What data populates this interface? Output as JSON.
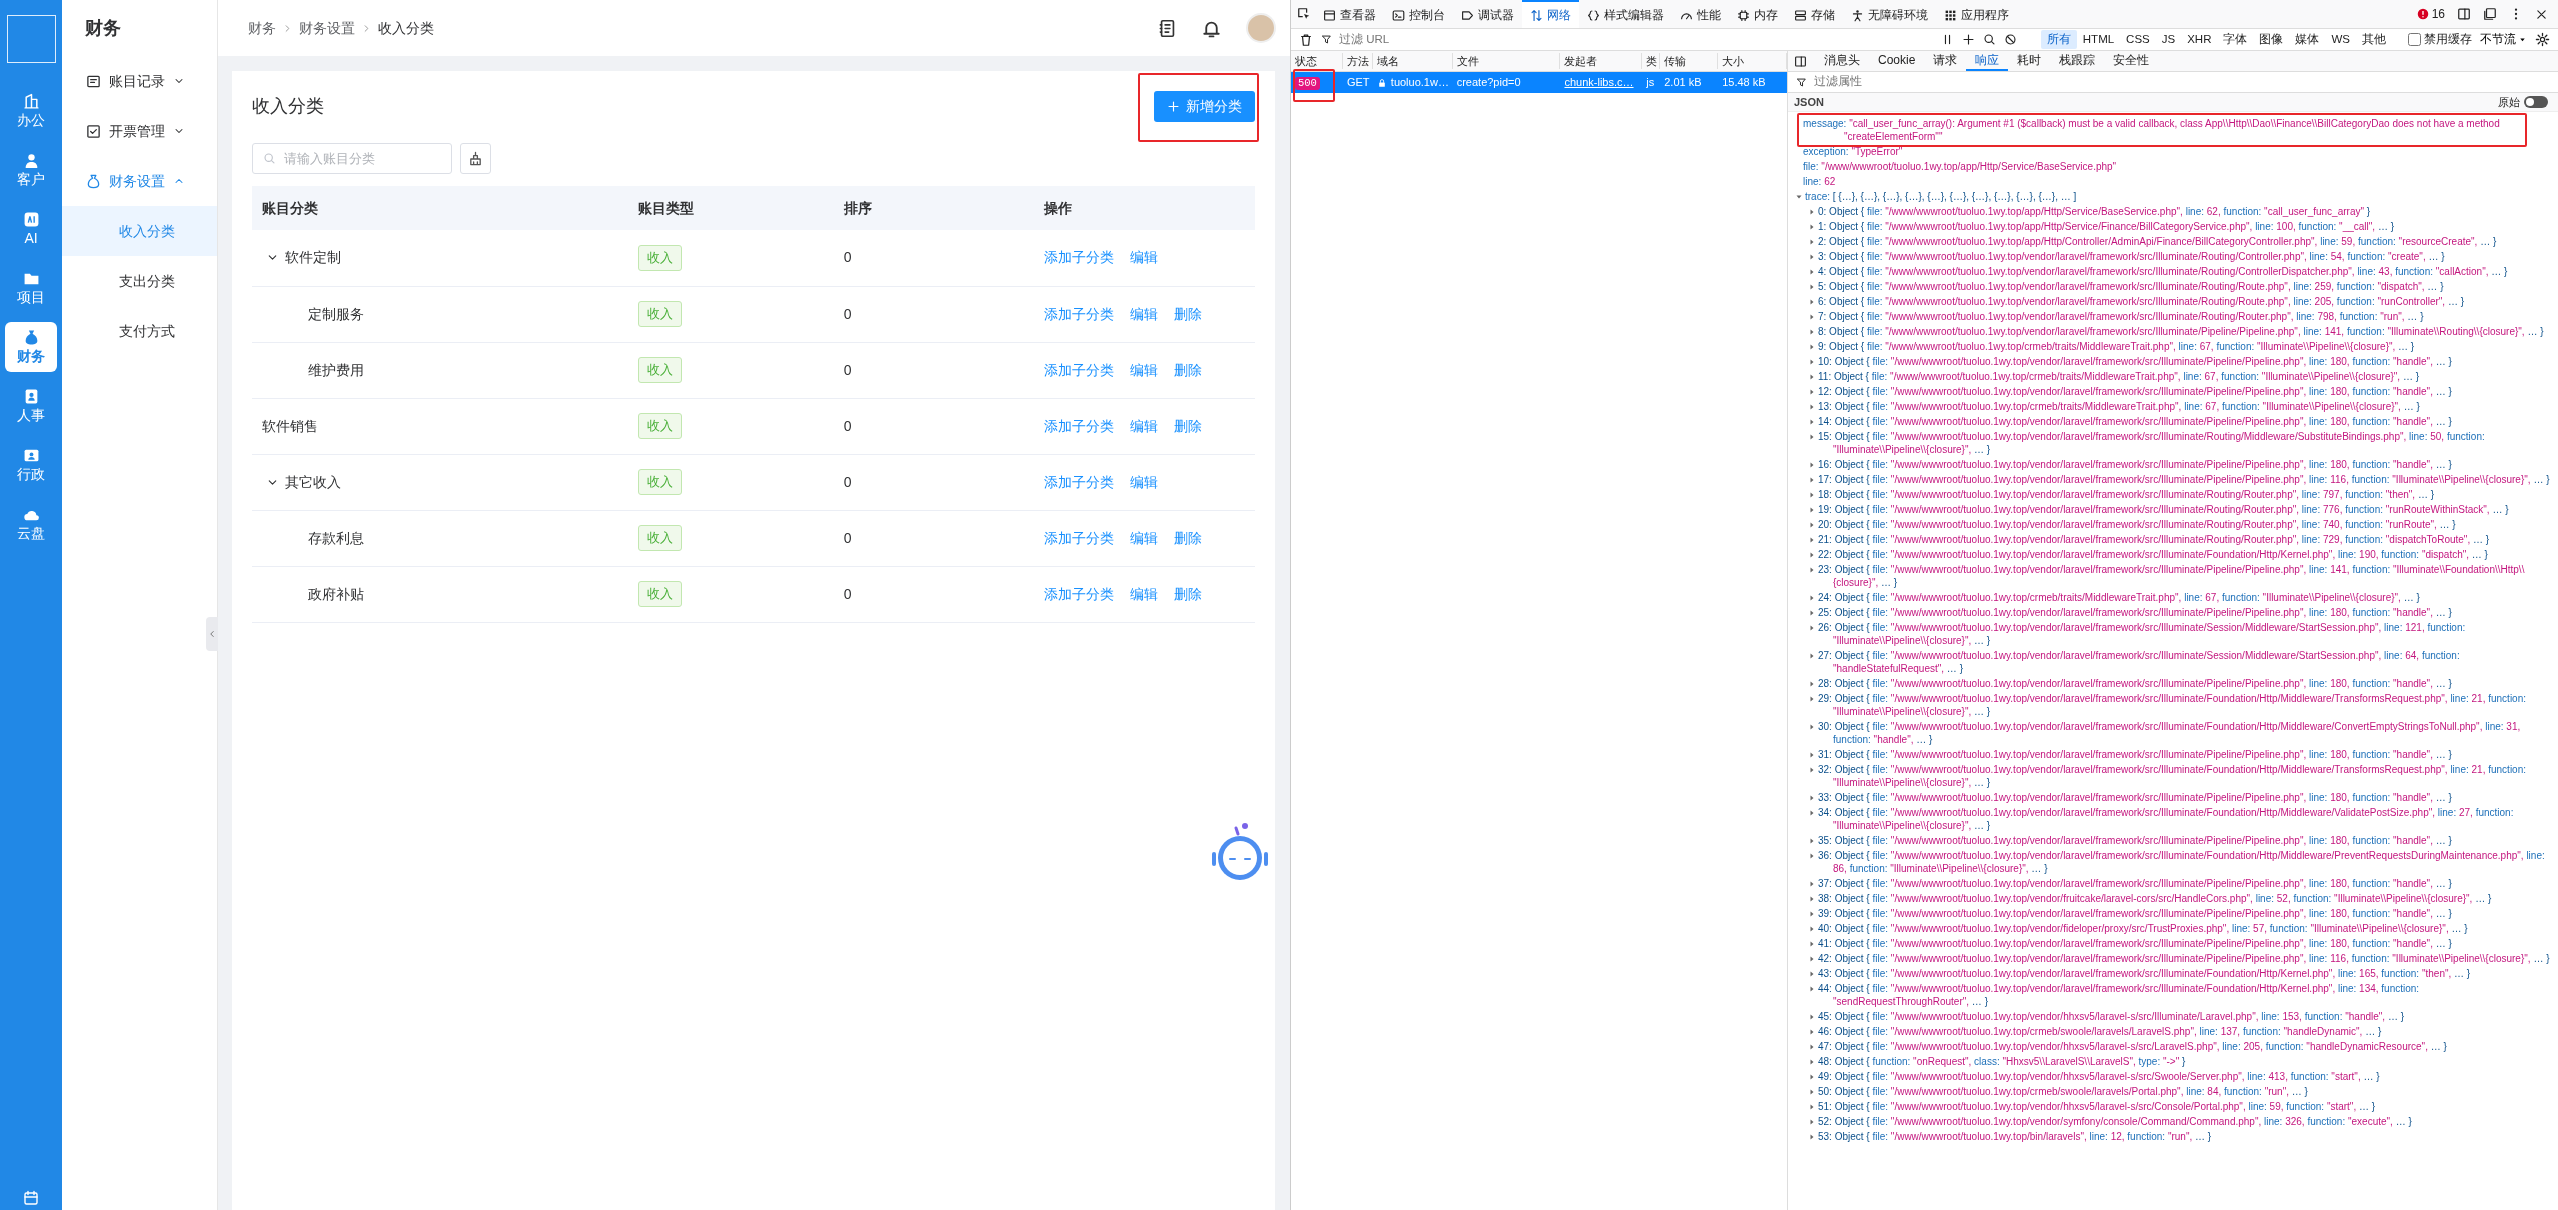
{
  "rail": {
    "items": [
      {
        "label": "办公",
        "selected": false
      },
      {
        "label": "客户",
        "selected": false
      },
      {
        "label": "AI",
        "selected": false
      },
      {
        "label": "项目",
        "selected": false
      },
      {
        "label": "财务",
        "selected": true
      },
      {
        "label": "人事",
        "selected": false
      },
      {
        "label": "行政",
        "selected": false
      },
      {
        "label": "云盘",
        "selected": false
      }
    ]
  },
  "subnav": {
    "title": "财务",
    "items": [
      {
        "label": "账目记录",
        "expanded": false
      },
      {
        "label": "开票管理",
        "expanded": false
      },
      {
        "label": "财务设置",
        "expanded": true,
        "children": [
          {
            "label": "收入分类",
            "selected": true
          },
          {
            "label": "支出分类",
            "selected": false
          },
          {
            "label": "支付方式",
            "selected": false
          }
        ]
      }
    ]
  },
  "breadcrumb": [
    "财务",
    "财务设置",
    "收入分类"
  ],
  "page": {
    "title": "收入分类",
    "add_button": {
      "label": "新增分类",
      "highlighted": true
    },
    "search": {
      "placeholder": "请输入账目分类"
    },
    "table": {
      "columns": [
        "账目分类",
        "账目类型",
        "排序",
        "操作"
      ],
      "rows": [
        {
          "name": "软件定制",
          "type": "收入",
          "sort": "0",
          "actions": [
            "添加子分类",
            "编辑"
          ],
          "expanded": true,
          "children": [
            {
              "name": "定制服务",
              "type": "收入",
              "sort": "0",
              "actions": [
                "添加子分类",
                "编辑",
                "删除"
              ]
            },
            {
              "name": "维护费用",
              "type": "收入",
              "sort": "0",
              "actions": [
                "添加子分类",
                "编辑",
                "删除"
              ]
            }
          ]
        },
        {
          "name": "软件销售",
          "type": "收入",
          "sort": "0",
          "actions": [
            "添加子分类",
            "编辑",
            "删除"
          ]
        },
        {
          "name": "其它收入",
          "type": "收入",
          "sort": "0",
          "actions": [
            "添加子分类",
            "编辑"
          ],
          "expanded": true,
          "children": [
            {
              "name": "存款利息",
              "type": "收入",
              "sort": "0",
              "actions": [
                "添加子分类",
                "编辑",
                "删除"
              ]
            },
            {
              "name": "政府补贴",
              "type": "收入",
              "sort": "0",
              "actions": [
                "添加子分类",
                "编辑",
                "删除"
              ]
            }
          ]
        }
      ]
    }
  },
  "devtools": {
    "tabs": [
      {
        "label": "查看器",
        "selected": false
      },
      {
        "label": "控制台",
        "selected": false
      },
      {
        "label": "调试器",
        "selected": false
      },
      {
        "label": "网络",
        "selected": true
      },
      {
        "label": "样式编辑器",
        "selected": false
      },
      {
        "label": "性能",
        "selected": false
      },
      {
        "label": "内存",
        "selected": false
      },
      {
        "label": "存储",
        "selected": false
      },
      {
        "label": "无障碍环境",
        "selected": false
      },
      {
        "label": "应用程序",
        "selected": false
      }
    ],
    "error_count": "16",
    "url_filter": {
      "placeholder": "过滤 URL"
    },
    "type_filters": [
      {
        "label": "所有",
        "selected": true
      },
      {
        "label": "HTML",
        "selected": false
      },
      {
        "label": "CSS",
        "selected": false
      },
      {
        "label": "JS",
        "selected": false
      },
      {
        "label": "XHR",
        "selected": false
      },
      {
        "label": "字体",
        "selected": false
      },
      {
        "label": "图像",
        "selected": false
      },
      {
        "label": "媒体",
        "selected": false
      },
      {
        "label": "WS",
        "selected": false
      },
      {
        "label": "其他",
        "selected": false
      }
    ],
    "disable_cache": {
      "label": "禁用缓存",
      "checked": false
    },
    "throttle": "不节流",
    "requests": {
      "columns": [
        "状态",
        "方法",
        "域名",
        "文件",
        "发起者",
        "类",
        "传输",
        "大小"
      ],
      "rows": [
        {
          "status": "500",
          "status_highlighted": true,
          "method": "GET",
          "domain": "tuoluo.1w…",
          "file": "create?pid=0",
          "initiator": "chunk-libs.c…",
          "type": "js",
          "transferred": "2.01 kB",
          "size": "15.48 kB",
          "selected": true
        }
      ]
    },
    "detail_tabs": [
      {
        "label": "消息头",
        "selected": false
      },
      {
        "label": "Cookie",
        "selected": false
      },
      {
        "label": "请求",
        "selected": false
      },
      {
        "label": "响应",
        "selected": true
      },
      {
        "label": "耗时",
        "selected": false
      },
      {
        "label": "栈跟踪",
        "selected": false
      },
      {
        "label": "安全性",
        "selected": false
      }
    ],
    "property_filter": {
      "placeholder": "过滤属性"
    },
    "view_label": "JSON",
    "raw_toggle": {
      "label": "原始",
      "on": false
    },
    "properties": [
      {
        "key": "message:",
        "value": "\"call_user_func_array(): Argument #1 ($callback) must be a valid callback, class App\\\\Http\\\\Dao\\\\Finance\\\\BillCategoryDao does not have a method \"createElementForm\"\"",
        "highlighted": true
      },
      {
        "key": "exception:",
        "value": "\"TypeError\"",
        "highlighted": false
      },
      {
        "key": "file:",
        "value": "\"/www/wwwroot/tuoluo.1wy.top/app/Http/Service/BaseService.php\"",
        "highlighted": false
      },
      {
        "key": "line:",
        "value": "62",
        "highlighted": false
      }
    ],
    "trace": {
      "key": "trace:",
      "summary": "[ {…}, {…}, {…}, {…}, {…}, {…}, {…}, {…}, {…}, {…}, … ]",
      "expanded": true,
      "entries": [
        {
          "head": "0: Object {",
          "fields": [
            {
              "key": "file:",
              "value": "\"/www/wwwroot/tuoluo.1wy.top/app/Http/Service/BaseService.php\","
            },
            {
              "key": "line:",
              "value": "62,"
            },
            {
              "key": "function:",
              "value": "\"call_user_func_array\""
            }
          ],
          "tail": "}"
        },
        {
          "head": "1: Object {",
          "fields": [
            {
              "key": "file:",
              "value": "\"/www/wwwroot/tuoluo.1wy.top/app/Http/Service/Finance/BillCategoryService.php\","
            },
            {
              "key": "line:",
              "value": "100,"
            },
            {
              "key": "function:",
              "value": "\"__call\","
            }
          ],
          "tail": "… }"
        },
        {
          "head": "2: Object {",
          "fields": [
            {
              "key": "file:",
              "value": "\"/www/wwwroot/tuoluo.1wy.top/app/Http/Controller/AdminApi/Finance/BillCategoryController.php\","
            },
            {
              "key": "line:",
              "value": "59,"
            },
            {
              "key": "function:",
              "value": "\"resourceCreate\","
            }
          ],
          "tail": "… }"
        },
        {
          "head": "3: Object {",
          "fields": [
            {
              "key": "file:",
              "value": "\"/www/wwwroot/tuoluo.1wy.top/vendor/laravel/framework/src/Illuminate/Routing/Controller.php\","
            },
            {
              "key": "line:",
              "value": "54,"
            },
            {
              "key": "function:",
              "value": "\"create\","
            }
          ],
          "tail": "… }"
        },
        {
          "head": "4: Object {",
          "fields": [
            {
              "key": "file:",
              "value": "\"/www/wwwroot/tuoluo.1wy.top/vendor/laravel/framework/src/Illuminate/Routing/ControllerDispatcher.php\","
            },
            {
              "key": "line:",
              "value": "43,"
            },
            {
              "key": "function:",
              "value": "\"callAction\","
            }
          ],
          "tail": "… }"
        },
        {
          "head": "5: Object {",
          "fields": [
            {
              "key": "file:",
              "value": "\"/www/wwwroot/tuoluo.1wy.top/vendor/laravel/framework/src/Illuminate/Routing/Route.php\","
            },
            {
              "key": "line:",
              "value": "259,"
            },
            {
              "key": "function:",
              "value": "\"dispatch\","
            }
          ],
          "tail": "… }"
        },
        {
          "head": "6: Object {",
          "fields": [
            {
              "key": "file:",
              "value": "\"/www/wwwroot/tuoluo.1wy.top/vendor/laravel/framework/src/Illuminate/Routing/Route.php\","
            },
            {
              "key": "line:",
              "value": "205,"
            },
            {
              "key": "function:",
              "value": "\"runController\","
            }
          ],
          "tail": "… }"
        },
        {
          "head": "7: Object {",
          "fields": [
            {
              "key": "file:",
              "value": "\"/www/wwwroot/tuoluo.1wy.top/vendor/laravel/framework/src/Illuminate/Routing/Router.php\","
            },
            {
              "key": "line:",
              "value": "798,"
            },
            {
              "key": "function:",
              "value": "\"run\","
            }
          ],
          "tail": "… }"
        },
        {
          "head": "8: Object {",
          "fields": [
            {
              "key": "file:",
              "value": "\"/www/wwwroot/tuoluo.1wy.top/vendor/laravel/framework/src/Illuminate/Pipeline/Pipeline.php\","
            },
            {
              "key": "line:",
              "value": "141,"
            },
            {
              "key": "function:",
              "value": "\"Illuminate\\\\Routing\\\\{closure}\","
            }
          ],
          "tail": "… }"
        },
        {
          "head": "9: Object {",
          "fields": [
            {
              "key": "file:",
              "value": "\"/www/wwwroot/tuoluo.1wy.top/crmeb/traits/MiddlewareTrait.php\","
            },
            {
              "key": "line:",
              "value": "67,"
            },
            {
              "key": "function:",
              "value": "\"Illuminate\\\\Pipeline\\\\{closure}\","
            }
          ],
          "tail": "… }"
        },
        {
          "head": "10: Object {",
          "fields": [
            {
              "key": "file:",
              "value": "\"/www/wwwroot/tuoluo.1wy.top/vendor/laravel/framework/src/Illuminate/Pipeline/Pipeline.php\","
            },
            {
              "key": "line:",
              "value": "180,"
            },
            {
              "key": "function:",
              "value": "\"handle\","
            }
          ],
          "tail": "… }"
        },
        {
          "head": "11: Object {",
          "fields": [
            {
              "key": "file:",
              "value": "\"/www/wwwroot/tuoluo.1wy.top/crmeb/traits/MiddlewareTrait.php\","
            },
            {
              "key": "line:",
              "value": "67,"
            },
            {
              "key": "function:",
              "value": "\"Illuminate\\\\Pipeline\\\\{closure}\","
            }
          ],
          "tail": "… }"
        },
        {
          "head": "12: Object {",
          "fields": [
            {
              "key": "file:",
              "value": "\"/www/wwwroot/tuoluo.1wy.top/vendor/laravel/framework/src/Illuminate/Pipeline/Pipeline.php\","
            },
            {
              "key": "line:",
              "value": "180,"
            },
            {
              "key": "function:",
              "value": "\"handle\","
            }
          ],
          "tail": "… }"
        },
        {
          "head": "13: Object {",
          "fields": [
            {
              "key": "file:",
              "value": "\"/www/wwwroot/tuoluo.1wy.top/crmeb/traits/MiddlewareTrait.php\","
            },
            {
              "key": "line:",
              "value": "67,"
            },
            {
              "key": "function:",
              "value": "\"Illuminate\\\\Pipeline\\\\{closure}\","
            }
          ],
          "tail": "… }"
        },
        {
          "head": "14: Object {",
          "fields": [
            {
              "key": "file:",
              "value": "\"/www/wwwroot/tuoluo.1wy.top/vendor/laravel/framework/src/Illuminate/Pipeline/Pipeline.php\","
            },
            {
              "key": "line:",
              "value": "180,"
            },
            {
              "key": "function:",
              "value": "\"handle\","
            }
          ],
          "tail": "… }"
        },
        {
          "head": "15: Object {",
          "fields": [
            {
              "key": "file:",
              "value": "\"/www/wwwroot/tuoluo.1wy.top/vendor/laravel/framework/src/Illuminate/Routing/Middleware/SubstituteBindings.php\","
            },
            {
              "key": "line:",
              "value": "50,"
            },
            {
              "key": "function:",
              "value": "\"Illuminate\\\\Pipeline\\\\{closure}\","
            }
          ],
          "tail": "… }"
        },
        {
          "head": "16: Object {",
          "fields": [
            {
              "key": "file:",
              "value": "\"/www/wwwroot/tuoluo.1wy.top/vendor/laravel/framework/src/Illuminate/Pipeline/Pipeline.php\","
            },
            {
              "key": "line:",
              "value": "180,"
            },
            {
              "key": "function:",
              "value": "\"handle\","
            }
          ],
          "tail": "… }"
        },
        {
          "head": "17: Object {",
          "fields": [
            {
              "key": "file:",
              "value": "\"/www/wwwroot/tuoluo.1wy.top/vendor/laravel/framework/src/Illuminate/Pipeline/Pipeline.php\","
            },
            {
              "key": "line:",
              "value": "116,"
            },
            {
              "key": "function:",
              "value": "\"Illuminate\\\\Pipeline\\\\{closure}\","
            }
          ],
          "tail": "… }"
        },
        {
          "head": "18: Object {",
          "fields": [
            {
              "key": "file:",
              "value": "\"/www/wwwroot/tuoluo.1wy.top/vendor/laravel/framework/src/Illuminate/Routing/Router.php\","
            },
            {
              "key": "line:",
              "value": "797,"
            },
            {
              "key": "function:",
              "value": "\"then\","
            }
          ],
          "tail": "… }"
        },
        {
          "head": "19: Object {",
          "fields": [
            {
              "key": "file:",
              "value": "\"/www/wwwroot/tuoluo.1wy.top/vendor/laravel/framework/src/Illuminate/Routing/Router.php\","
            },
            {
              "key": "line:",
              "value": "776,"
            },
            {
              "key": "function:",
              "value": "\"runRouteWithinStack\","
            }
          ],
          "tail": "… }"
        },
        {
          "head": "20: Object {",
          "fields": [
            {
              "key": "file:",
              "value": "\"/www/wwwroot/tuoluo.1wy.top/vendor/laravel/framework/src/Illuminate/Routing/Router.php\","
            },
            {
              "key": "line:",
              "value": "740,"
            },
            {
              "key": "function:",
              "value": "\"runRoute\","
            }
          ],
          "tail": "… }"
        },
        {
          "head": "21: Object {",
          "fields": [
            {
              "key": "file:",
              "value": "\"/www/wwwroot/tuoluo.1wy.top/vendor/laravel/framework/src/Illuminate/Routing/Router.php\","
            },
            {
              "key": "line:",
              "value": "729,"
            },
            {
              "key": "function:",
              "value": "\"dispatchToRoute\","
            }
          ],
          "tail": "… }"
        },
        {
          "head": "22: Object {",
          "fields": [
            {
              "key": "file:",
              "value": "\"/www/wwwroot/tuoluo.1wy.top/vendor/laravel/framework/src/Illuminate/Foundation/Http/Kernel.php\","
            },
            {
              "key": "line:",
              "value": "190,"
            },
            {
              "key": "function:",
              "value": "\"dispatch\","
            }
          ],
          "tail": "… }"
        },
        {
          "head": "23: Object {",
          "fields": [
            {
              "key": "file:",
              "value": "\"/www/wwwroot/tuoluo.1wy.top/vendor/laravel/framework/src/Illuminate/Pipeline/Pipeline.php\","
            },
            {
              "key": "line:",
              "value": "141,"
            },
            {
              "key": "function:",
              "value": "\"Illuminate\\\\Foundation\\\\Http\\\\{closure}\","
            }
          ],
          "tail": "… }"
        },
        {
          "head": "24: Object {",
          "fields": [
            {
              "key": "file:",
              "value": "\"/www/wwwroot/tuoluo.1wy.top/crmeb/traits/MiddlewareTrait.php\","
            },
            {
              "key": "line:",
              "value": "67,"
            },
            {
              "key": "function:",
              "value": "\"Illuminate\\\\Pipeline\\\\{closure}\","
            }
          ],
          "tail": "… }"
        },
        {
          "head": "25: Object {",
          "fields": [
            {
              "key": "file:",
              "value": "\"/www/wwwroot/tuoluo.1wy.top/vendor/laravel/framework/src/Illuminate/Pipeline/Pipeline.php\","
            },
            {
              "key": "line:",
              "value": "180,"
            },
            {
              "key": "function:",
              "value": "\"handle\","
            }
          ],
          "tail": "… }"
        },
        {
          "head": "26: Object {",
          "fields": [
            {
              "key": "file:",
              "value": "\"/www/wwwroot/tuoluo.1wy.top/vendor/laravel/framework/src/Illuminate/Session/Middleware/StartSession.php\","
            },
            {
              "key": "line:",
              "value": "121,"
            },
            {
              "key": "function:",
              "value": "\"Illuminate\\\\Pipeline\\\\{closure}\","
            }
          ],
          "tail": "… }"
        },
        {
          "head": "27: Object {",
          "fields": [
            {
              "key": "file:",
              "value": "\"/www/wwwroot/tuoluo.1wy.top/vendor/laravel/framework/src/Illuminate/Session/Middleware/StartSession.php\","
            },
            {
              "key": "line:",
              "value": "64,"
            },
            {
              "key": "function:",
              "value": "\"handleStatefulRequest\","
            }
          ],
          "tail": "… }"
        },
        {
          "head": "28: Object {",
          "fields": [
            {
              "key": "file:",
              "value": "\"/www/wwwroot/tuoluo.1wy.top/vendor/laravel/framework/src/Illuminate/Pipeline/Pipeline.php\","
            },
            {
              "key": "line:",
              "value": "180,"
            },
            {
              "key": "function:",
              "value": "\"handle\","
            }
          ],
          "tail": "… }"
        },
        {
          "head": "29: Object {",
          "fields": [
            {
              "key": "file:",
              "value": "\"/www/wwwroot/tuoluo.1wy.top/vendor/laravel/framework/src/Illuminate/Foundation/Http/Middleware/TransformsRequest.php\","
            },
            {
              "key": "line:",
              "value": "21,"
            },
            {
              "key": "function:",
              "value": "\"Illuminate\\\\Pipeline\\\\{closure}\","
            }
          ],
          "tail": "… }"
        },
        {
          "head": "30: Object {",
          "fields": [
            {
              "key": "file:",
              "value": "\"/www/wwwroot/tuoluo.1wy.top/vendor/laravel/framework/src/Illuminate/Foundation/Http/Middleware/ConvertEmptyStringsToNull.php\","
            },
            {
              "key": "line:",
              "value": "31,"
            },
            {
              "key": "function:",
              "value": "\"handle\","
            }
          ],
          "tail": "… }"
        },
        {
          "head": "31: Object {",
          "fields": [
            {
              "key": "file:",
              "value": "\"/www/wwwroot/tuoluo.1wy.top/vendor/laravel/framework/src/Illuminate/Pipeline/Pipeline.php\","
            },
            {
              "key": "line:",
              "value": "180,"
            },
            {
              "key": "function:",
              "value": "\"handle\","
            }
          ],
          "tail": "… }"
        },
        {
          "head": "32: Object {",
          "fields": [
            {
              "key": "file:",
              "value": "\"/www/wwwroot/tuoluo.1wy.top/vendor/laravel/framework/src/Illuminate/Foundation/Http/Middleware/TransformsRequest.php\","
            },
            {
              "key": "line:",
              "value": "21,"
            },
            {
              "key": "function:",
              "value": "\"Illuminate\\\\Pipeline\\\\{closure}\","
            }
          ],
          "tail": "… }"
        },
        {
          "head": "33: Object {",
          "fields": [
            {
              "key": "file:",
              "value": "\"/www/wwwroot/tuoluo.1wy.top/vendor/laravel/framework/src/Illuminate/Pipeline/Pipeline.php\","
            },
            {
              "key": "line:",
              "value": "180,"
            },
            {
              "key": "function:",
              "value": "\"handle\","
            }
          ],
          "tail": "… }"
        },
        {
          "head": "34: Object {",
          "fields": [
            {
              "key": "file:",
              "value": "\"/www/wwwroot/tuoluo.1wy.top/vendor/laravel/framework/src/Illuminate/Foundation/Http/Middleware/ValidatePostSize.php\","
            },
            {
              "key": "line:",
              "value": "27,"
            },
            {
              "key": "function:",
              "value": "\"Illuminate\\\\Pipeline\\\\{closure}\","
            }
          ],
          "tail": "… }"
        },
        {
          "head": "35: Object {",
          "fields": [
            {
              "key": "file:",
              "value": "\"/www/wwwroot/tuoluo.1wy.top/vendor/laravel/framework/src/Illuminate/Pipeline/Pipeline.php\","
            },
            {
              "key": "line:",
              "value": "180,"
            },
            {
              "key": "function:",
              "value": "\"handle\","
            }
          ],
          "tail": "… }"
        },
        {
          "head": "36: Object {",
          "fields": [
            {
              "key": "file:",
              "value": "\"/www/wwwroot/tuoluo.1wy.top/vendor/laravel/framework/src/Illuminate/Foundation/Http/Middleware/PreventRequestsDuringMaintenance.php\","
            },
            {
              "key": "line:",
              "value": "86,"
            },
            {
              "key": "function:",
              "value": "\"Illuminate\\\\Pipeline\\\\{closure}\","
            }
          ],
          "tail": "… }"
        },
        {
          "head": "37: Object {",
          "fields": [
            {
              "key": "file:",
              "value": "\"/www/wwwroot/tuoluo.1wy.top/vendor/laravel/framework/src/Illuminate/Pipeline/Pipeline.php\","
            },
            {
              "key": "line:",
              "value": "180,"
            },
            {
              "key": "function:",
              "value": "\"handle\","
            }
          ],
          "tail": "… }"
        },
        {
          "head": "38: Object {",
          "fields": [
            {
              "key": "file:",
              "value": "\"/www/wwwroot/tuoluo.1wy.top/vendor/fruitcake/laravel-cors/src/HandleCors.php\","
            },
            {
              "key": "line:",
              "value": "52,"
            },
            {
              "key": "function:",
              "value": "\"Illuminate\\\\Pipeline\\\\{closure}\","
            }
          ],
          "tail": "… }"
        },
        {
          "head": "39: Object {",
          "fields": [
            {
              "key": "file:",
              "value": "\"/www/wwwroot/tuoluo.1wy.top/vendor/laravel/framework/src/Illuminate/Pipeline/Pipeline.php\","
            },
            {
              "key": "line:",
              "value": "180,"
            },
            {
              "key": "function:",
              "value": "\"handle\","
            }
          ],
          "tail": "… }"
        },
        {
          "head": "40: Object {",
          "fields": [
            {
              "key": "file:",
              "value": "\"/www/wwwroot/tuoluo.1wy.top/vendor/fideloper/proxy/src/TrustProxies.php\","
            },
            {
              "key": "line:",
              "value": "57,"
            },
            {
              "key": "function:",
              "value": "\"Illuminate\\\\Pipeline\\\\{closure}\","
            }
          ],
          "tail": "… }"
        },
        {
          "head": "41: Object {",
          "fields": [
            {
              "key": "file:",
              "value": "\"/www/wwwroot/tuoluo.1wy.top/vendor/laravel/framework/src/Illuminate/Pipeline/Pipeline.php\","
            },
            {
              "key": "line:",
              "value": "180,"
            },
            {
              "key": "function:",
              "value": "\"handle\","
            }
          ],
          "tail": "… }"
        },
        {
          "head": "42: Object {",
          "fields": [
            {
              "key": "file:",
              "value": "\"/www/wwwroot/tuoluo.1wy.top/vendor/laravel/framework/src/Illuminate/Pipeline/Pipeline.php\","
            },
            {
              "key": "line:",
              "value": "116,"
            },
            {
              "key": "function:",
              "value": "\"Illuminate\\\\Pipeline\\\\{closure}\","
            }
          ],
          "tail": "… }"
        },
        {
          "head": "43: Object {",
          "fields": [
            {
              "key": "file:",
              "value": "\"/www/wwwroot/tuoluo.1wy.top/vendor/laravel/framework/src/Illuminate/Foundation/Http/Kernel.php\","
            },
            {
              "key": "line:",
              "value": "165,"
            },
            {
              "key": "function:",
              "value": "\"then\","
            }
          ],
          "tail": "… }"
        },
        {
          "head": "44: Object {",
          "fields": [
            {
              "key": "file:",
              "value": "\"/www/wwwroot/tuoluo.1wy.top/vendor/laravel/framework/src/Illuminate/Foundation/Http/Kernel.php\","
            },
            {
              "key": "line:",
              "value": "134,"
            },
            {
              "key": "function:",
              "value": "\"sendRequestThroughRouter\","
            }
          ],
          "tail": "… }"
        },
        {
          "head": "45: Object {",
          "fields": [
            {
              "key": "file:",
              "value": "\"/www/wwwroot/tuoluo.1wy.top/vendor/hhxsv5/laravel-s/src/Illuminate/Laravel.php\","
            },
            {
              "key": "line:",
              "value": "153,"
            },
            {
              "key": "function:",
              "value": "\"handle\","
            }
          ],
          "tail": "… }"
        },
        {
          "head": "46: Object {",
          "fields": [
            {
              "key": "file:",
              "value": "\"/www/wwwroot/tuoluo.1wy.top/crmeb/swoole/laravels/LaravelS.php\","
            },
            {
              "key": "line:",
              "value": "137,"
            },
            {
              "key": "function:",
              "value": "\"handleDynamic\","
            }
          ],
          "tail": "… }"
        },
        {
          "head": "47: Object {",
          "fields": [
            {
              "key": "file:",
              "value": "\"/www/wwwroot/tuoluo.1wy.top/vendor/hhxsv5/laravel-s/src/LaravelS.php\","
            },
            {
              "key": "line:",
              "value": "205,"
            },
            {
              "key": "function:",
              "value": "\"handleDynamicResource\","
            }
          ],
          "tail": "… }"
        },
        {
          "head": "48: Object {",
          "fields": [
            {
              "key": "function:",
              "value": "\"onRequest\","
            },
            {
              "key": "class:",
              "value": "\"Hhxsv5\\\\LaravelS\\\\LaravelS\","
            },
            {
              "key": "type:",
              "value": "\"->\""
            }
          ],
          "tail": "}"
        },
        {
          "head": "49: Object {",
          "fields": [
            {
              "key": "file:",
              "value": "\"/www/wwwroot/tuoluo.1wy.top/vendor/hhxsv5/laravel-s/src/Swoole/Server.php\","
            },
            {
              "key": "line:",
              "value": "413,"
            },
            {
              "key": "function:",
              "value": "\"start\","
            }
          ],
          "tail": "… }"
        },
        {
          "head": "50: Object {",
          "fields": [
            {
              "key": "file:",
              "value": "\"/www/wwwroot/tuoluo.1wy.top/crmeb/swoole/laravels/Portal.php\","
            },
            {
              "key": "line:",
              "value": "84,"
            },
            {
              "key": "function:",
              "value": "\"run\","
            }
          ],
          "tail": "… }"
        },
        {
          "head": "51: Object {",
          "fields": [
            {
              "key": "file:",
              "value": "\"/www/wwwroot/tuoluo.1wy.top/vendor/hhxsv5/laravel-s/src/Console/Portal.php\","
            },
            {
              "key": "line:",
              "value": "59,"
            },
            {
              "key": "function:",
              "value": "\"start\","
            }
          ],
          "tail": "… }"
        },
        {
          "head": "52: Object {",
          "fields": [
            {
              "key": "file:",
              "value": "\"/www/wwwroot/tuoluo.1wy.top/vendor/symfony/console/Command/Command.php\","
            },
            {
              "key": "line:",
              "value": "326,"
            },
            {
              "key": "function:",
              "value": "\"execute\","
            }
          ],
          "tail": "… }"
        },
        {
          "head": "53: Object {",
          "fields": [
            {
              "key": "file:",
              "value": "\"/www/wwwroot/tuoluo.1wy.top/bin/laravels\","
            },
            {
              "key": "line:",
              "value": "12,"
            },
            {
              "key": "function:",
              "value": "\"run\","
            }
          ],
          "tail": "… }"
        }
      ]
    }
  }
}
